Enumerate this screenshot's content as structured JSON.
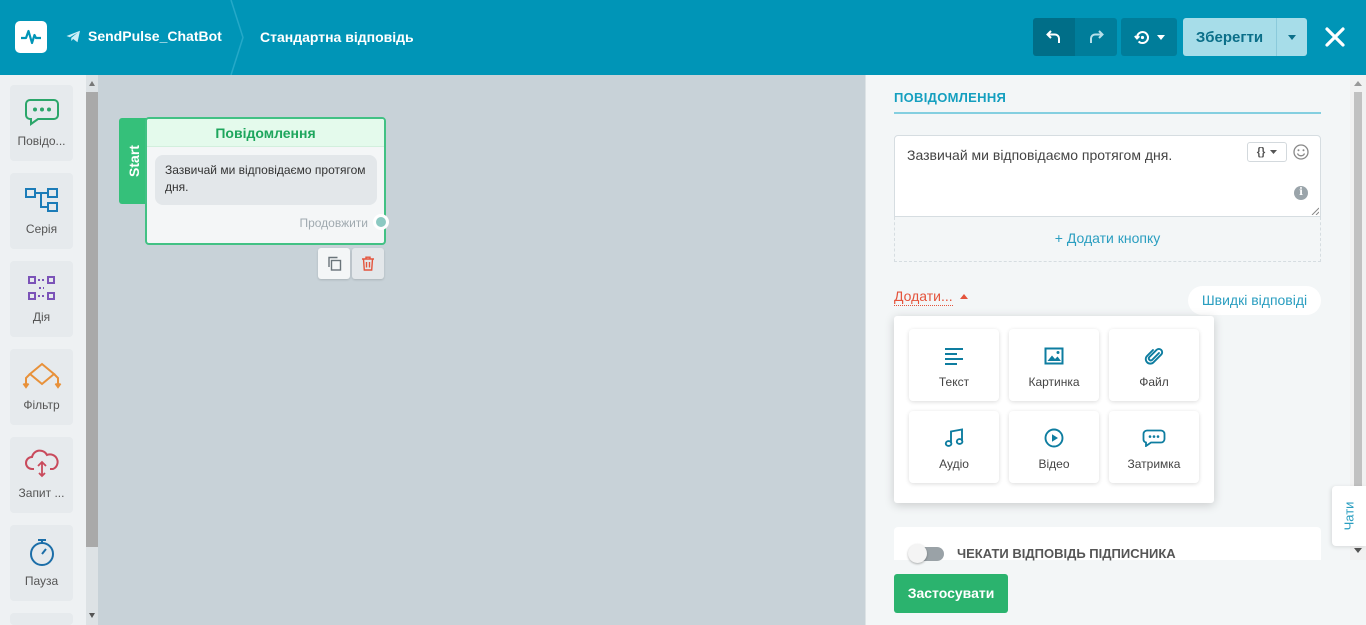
{
  "header": {
    "bot_name": "SendPulse_ChatBot",
    "flow_title": "Стандартна відповідь",
    "save_label": "Зберегти"
  },
  "palette": {
    "items": [
      {
        "label": "Повідо...",
        "icon": "message-bubble-icon"
      },
      {
        "label": "Серія",
        "icon": "chain-icon"
      },
      {
        "label": "Дія",
        "icon": "action-icon"
      },
      {
        "label": "Фільтр",
        "icon": "filter-icon"
      },
      {
        "label": "Запит ...",
        "icon": "cloud-request-icon"
      },
      {
        "label": "Пауза",
        "icon": "stopwatch-icon"
      }
    ]
  },
  "canvas": {
    "start_label": "Start",
    "node": {
      "title": "Повідомлення",
      "message": "Зазвичай ми відповідаємо протягом дня.",
      "continue_label": "Продовжити"
    }
  },
  "panel": {
    "section_title": "ПОВІДОМЛЕННЯ",
    "message_text": "Зазвичай ми відповідаємо протягом дня.",
    "var_label": "{}",
    "add_button_label": "+ Додати кнопку",
    "add_menu_label": "Додати...",
    "quick_replies_label": "Швидкі відповіді",
    "add_options": [
      {
        "label": "Текст",
        "icon": "text-lines-icon"
      },
      {
        "label": "Картинка",
        "icon": "image-icon"
      },
      {
        "label": "Файл",
        "icon": "paperclip-icon"
      },
      {
        "label": "Аудіо",
        "icon": "music-note-icon"
      },
      {
        "label": "Відео",
        "icon": "play-circle-icon"
      },
      {
        "label": "Затримка",
        "icon": "typing-bubble-icon"
      }
    ],
    "wait_reply_label": "ЧЕКАТИ ВІДПОВІДЬ ПІДПИСНИКА",
    "apply_label": "Застосувати",
    "chats_label": "Чати"
  },
  "colors": {
    "header_bg": "#0095b7",
    "accent_green": "#2bb36e",
    "link_blue": "#2a9ec0",
    "warning_red": "#e4543c"
  }
}
